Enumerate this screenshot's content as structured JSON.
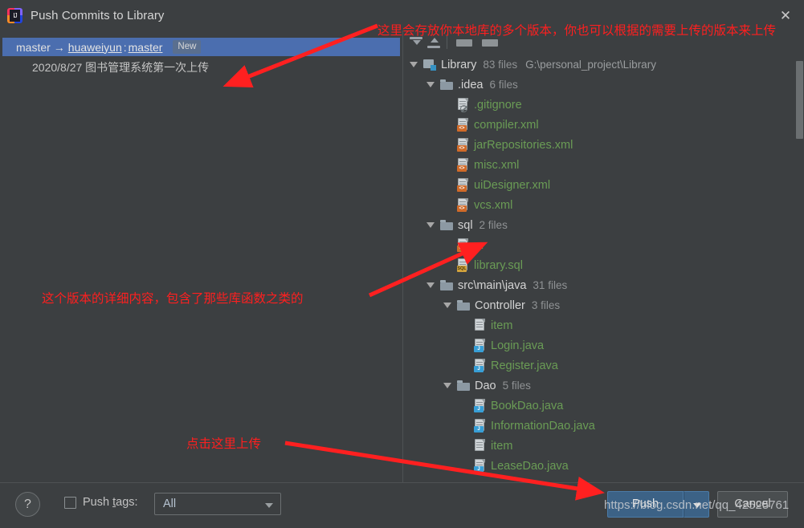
{
  "window": {
    "title": "Push Commits to Library",
    "app_icon": "intellij-idea-icon",
    "close_label": "✕"
  },
  "commit_panel": {
    "branch_row": {
      "local_branch": "master",
      "arrow": "→",
      "remote_name": "huaweiyun",
      "separator": ":",
      "remote_branch": "master",
      "status_badge": "New"
    },
    "commits": [
      {
        "message": "2020/8/27 图书管理系统第一次上传"
      }
    ]
  },
  "tree_panel": {
    "toolbar": [
      {
        "name": "expand-all-icon",
        "label": "Expand All"
      },
      {
        "name": "collapse-all-icon",
        "label": "Collapse All"
      },
      {
        "name": "group-by-directory-icon",
        "label": "Group By Directory"
      },
      {
        "name": "flatten-packages-icon",
        "label": "Flatten Packages"
      }
    ],
    "nodes": [
      {
        "indent": 0,
        "twisty": true,
        "icon": "module-root-icon",
        "kind": "root",
        "name": "Library",
        "count": "83 files",
        "path": "G:\\personal_project\\Library"
      },
      {
        "indent": 1,
        "twisty": true,
        "icon": "folder-icon",
        "kind": "dir",
        "name": ".idea",
        "count": "6 files",
        "path": ""
      },
      {
        "indent": 2,
        "twisty": false,
        "icon": "gitignore-file-icon",
        "kind": "file",
        "name": ".gitignore",
        "count": "",
        "path": ""
      },
      {
        "indent": 2,
        "twisty": false,
        "icon": "xml-file-icon",
        "kind": "file",
        "name": "compiler.xml",
        "count": "",
        "path": ""
      },
      {
        "indent": 2,
        "twisty": false,
        "icon": "xml-file-icon",
        "kind": "file",
        "name": "jarRepositories.xml",
        "count": "",
        "path": ""
      },
      {
        "indent": 2,
        "twisty": false,
        "icon": "xml-file-icon",
        "kind": "file",
        "name": "misc.xml",
        "count": "",
        "path": ""
      },
      {
        "indent": 2,
        "twisty": false,
        "icon": "xml-file-icon",
        "kind": "file",
        "name": "uiDesigner.xml",
        "count": "",
        "path": ""
      },
      {
        "indent": 2,
        "twisty": false,
        "icon": "xml-file-icon",
        "kind": "file",
        "name": "vcs.xml",
        "count": "",
        "path": ""
      },
      {
        "indent": 1,
        "twisty": true,
        "icon": "folder-icon",
        "kind": "dir",
        "name": "sql",
        "count": "2 files",
        "path": ""
      },
      {
        "indent": 2,
        "twisty": false,
        "icon": "xml-file-icon",
        "kind": "file",
        "name": "m",
        "count": "",
        "path": ""
      },
      {
        "indent": 2,
        "twisty": false,
        "icon": "sql-file-icon",
        "kind": "file",
        "name": "library.sql",
        "count": "",
        "path": ""
      },
      {
        "indent": 1,
        "twisty": true,
        "icon": "folder-icon",
        "kind": "dir",
        "name": "src\\main\\java",
        "count": "31 files",
        "path": ""
      },
      {
        "indent": 2,
        "twisty": true,
        "icon": "folder-icon",
        "kind": "dir",
        "name": "Controller",
        "count": "3 files",
        "path": ""
      },
      {
        "indent": 3,
        "twisty": false,
        "icon": "generic-file-icon",
        "kind": "file",
        "name": "item",
        "count": "",
        "path": ""
      },
      {
        "indent": 3,
        "twisty": false,
        "icon": "java-file-icon",
        "kind": "file",
        "name": "Login.java",
        "count": "",
        "path": ""
      },
      {
        "indent": 3,
        "twisty": false,
        "icon": "java-file-icon",
        "kind": "file",
        "name": "Register.java",
        "count": "",
        "path": ""
      },
      {
        "indent": 2,
        "twisty": true,
        "icon": "folder-icon",
        "kind": "dir",
        "name": "Dao",
        "count": "5 files",
        "path": ""
      },
      {
        "indent": 3,
        "twisty": false,
        "icon": "java-file-icon",
        "kind": "file",
        "name": "BookDao.java",
        "count": "",
        "path": ""
      },
      {
        "indent": 3,
        "twisty": false,
        "icon": "java-file-icon",
        "kind": "file",
        "name": "InformationDao.java",
        "count": "",
        "path": ""
      },
      {
        "indent": 3,
        "twisty": false,
        "icon": "generic-file-icon",
        "kind": "file",
        "name": "item",
        "count": "",
        "path": ""
      },
      {
        "indent": 3,
        "twisty": false,
        "icon": "java-file-icon",
        "kind": "file",
        "name": "LeaseDao.java",
        "count": "",
        "path": ""
      }
    ]
  },
  "bottom_bar": {
    "help_label": "?",
    "push_tags_checkbox_checked": false,
    "push_tags_label_pre": "Push ",
    "push_tags_label_key": "t",
    "push_tags_label_post": "ags:",
    "tags_value": "All",
    "tags_options": [
      "All"
    ],
    "push_label": "Push",
    "cancel_label": "Cancel"
  },
  "annotations": [
    {
      "id": "ann-versions",
      "text": "这里会存放你本地库的多个版本，你也可以根据的需要上传的版本来上传"
    },
    {
      "id": "ann-details",
      "text": "这个版本的详细内容，包含了那些库函数之类的"
    },
    {
      "id": "ann-click-upload",
      "text": "点击这里上传"
    }
  ],
  "watermark": {
    "text": "https://blog.csdn.net/qq_42525761"
  },
  "colors": {
    "background": "#3c3f41",
    "selection": "#4b6eaf",
    "accent_button": "#3c6286",
    "file_text": "#6a9c55",
    "annotation_red": "#ff1f1f",
    "xml_badge": "#cf6a29",
    "java_badge": "#389fd6",
    "sql_badge": "#d2a23c"
  }
}
